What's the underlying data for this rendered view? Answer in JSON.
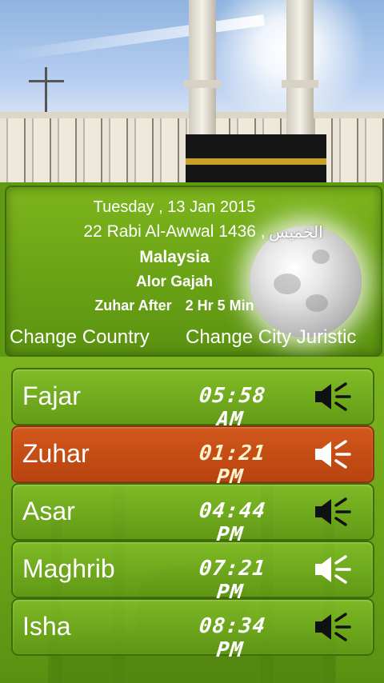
{
  "header": {
    "date": "Tuesday , 13 Jan 2015",
    "hijri_date": "22 Rabi Al-Awwal 1436",
    "arabic_day": "الخميس",
    "country": "Malaysia",
    "city": "Alor Gajah",
    "next_prayer_label": "Zuhar After",
    "next_prayer_remaining": "2 Hr 5 Min"
  },
  "actions": {
    "change_country": "Change Country",
    "change_city": "Change City Juristic"
  },
  "prayers": [
    {
      "name": "Fajar",
      "time": "05:58 AM",
      "active": false,
      "sound": "muted"
    },
    {
      "name": "Zuhar",
      "time": "01:21 PM",
      "active": true,
      "sound": "on"
    },
    {
      "name": "Asar",
      "time": "04:44 PM",
      "active": false,
      "sound": "muted"
    },
    {
      "name": "Maghrib",
      "time": "07:21 PM",
      "active": false,
      "sound": "on"
    },
    {
      "name": "Isha",
      "time": "08:34 PM",
      "active": false,
      "sound": "muted"
    }
  ],
  "colors": {
    "panel_green": "#6fa817",
    "active_orange": "#c84d15",
    "text": "#ffffff"
  },
  "icons": {
    "speaker": "speaker-icon",
    "moon": "moon-icon"
  }
}
